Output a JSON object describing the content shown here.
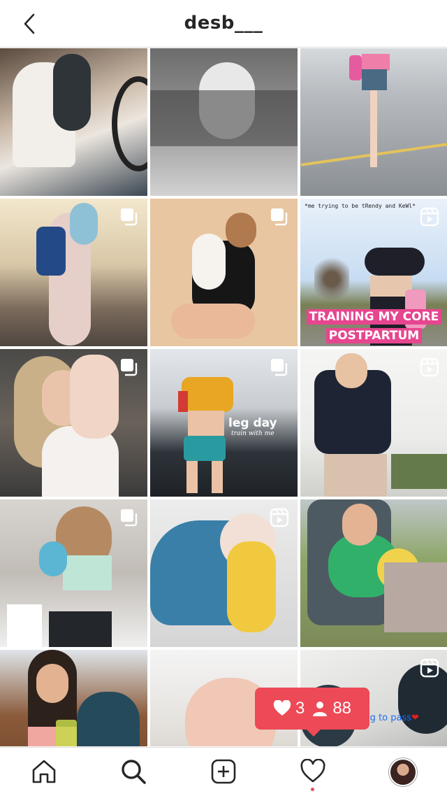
{
  "header": {
    "title": "desb___",
    "back_icon": "chevron-left-icon"
  },
  "posts": [
    {
      "name": "post-1",
      "badge": ""
    },
    {
      "name": "post-2",
      "badge": ""
    },
    {
      "name": "post-3",
      "badge": ""
    },
    {
      "name": "post-4",
      "badge": "carousel"
    },
    {
      "name": "post-5",
      "badge": "carousel"
    },
    {
      "name": "post-6",
      "badge": "reel",
      "caption": "*me trying to be tRendy and KeWl*",
      "overlay_line1": "TRAINING MY CORE",
      "overlay_line2": "POSTPARTUM"
    },
    {
      "name": "post-7",
      "badge": "carousel"
    },
    {
      "name": "post-8",
      "badge": "carousel",
      "overlay_title": "leg day",
      "overlay_sub": "train with me"
    },
    {
      "name": "post-9",
      "badge": "reel"
    },
    {
      "name": "post-10",
      "badge": "carousel"
    },
    {
      "name": "post-11",
      "badge": "reel"
    },
    {
      "name": "post-12",
      "badge": ""
    },
    {
      "name": "post-13",
      "badge": ""
    },
    {
      "name": "post-14",
      "badge": ""
    },
    {
      "name": "post-15",
      "badge": "reel",
      "overlay_text": "he's going to pass"
    }
  ],
  "notification": {
    "likes": "3",
    "followers": "88"
  },
  "bottom_nav": {
    "items": [
      "home-icon",
      "search-icon",
      "new-post-icon",
      "activity-icon",
      "profile-avatar"
    ]
  },
  "colors": {
    "accent": "#ed4956",
    "border": "#dbdbdb",
    "text": "#262626"
  }
}
